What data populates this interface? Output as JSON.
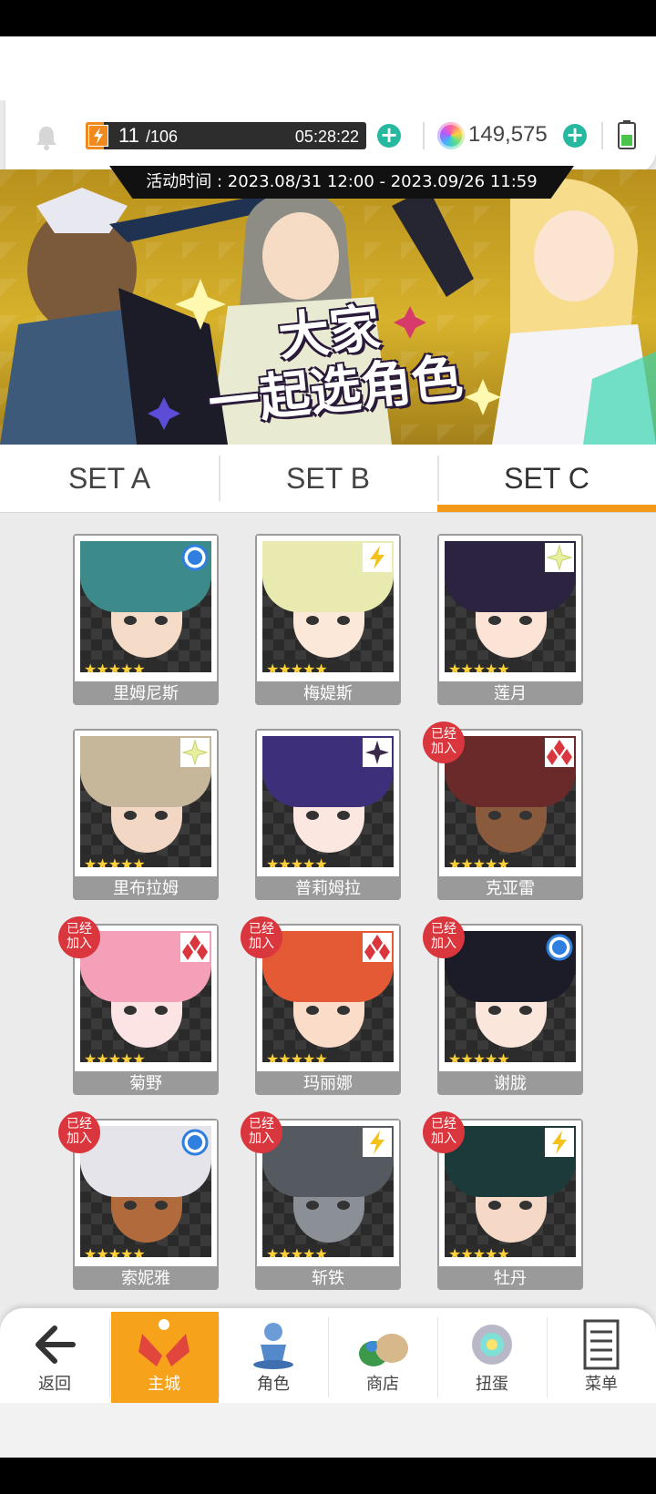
{
  "status": {
    "stamina_current": "11",
    "stamina_max": "/106",
    "stamina_timer": "05:28:22",
    "gems": "149,575",
    "icons": [
      "bell-icon",
      "lightning-icon",
      "plus-icon",
      "gem-icon",
      "battery-icon"
    ]
  },
  "banner": {
    "event_time": "活动时间 : 2023.08/31 12:00 - 2023.09/26 11:59",
    "title_line1": "大家",
    "title_line2": "一起选角色"
  },
  "tabs": [
    {
      "label": "SET A",
      "selected": false
    },
    {
      "label": "SET B",
      "selected": false
    },
    {
      "label": "SET C",
      "selected": true
    }
  ],
  "colors": {
    "accent": "#f39a18",
    "joined_badge": "#d9363e",
    "star": "#ffd13b",
    "plus_button": "#27b8a0"
  },
  "characters": [
    {
      "name": "里姆尼斯",
      "stars": "★★★★★",
      "attribute": "circle-icon",
      "joined": false
    },
    {
      "name": "梅媞斯",
      "stars": "★★★★★",
      "attribute": "lightning-icon",
      "joined": false
    },
    {
      "name": "莲月",
      "stars": "★★★★★",
      "attribute": "sparkle-icon",
      "joined": false
    },
    {
      "name": "里布拉姆",
      "stars": "★★★★★",
      "attribute": "sparkle-icon",
      "joined": false
    },
    {
      "name": "普莉姆拉",
      "stars": "★★★★★",
      "attribute": "dark-star-icon",
      "joined": false
    },
    {
      "name": "克亚雷",
      "stars": "★★★★★",
      "attribute": "diamonds-icon",
      "joined": true
    },
    {
      "name": "菊野",
      "stars": "★★★★★",
      "attribute": "diamonds-icon",
      "joined": true
    },
    {
      "name": "玛丽娜",
      "stars": "★★★★★",
      "attribute": "diamonds-icon",
      "joined": true
    },
    {
      "name": "谢胧",
      "stars": "★★★★★",
      "attribute": "circle-icon",
      "joined": true
    },
    {
      "name": "索妮雅",
      "stars": "★★★★★",
      "attribute": "circle-icon",
      "joined": true
    },
    {
      "name": "斩铁",
      "stars": "★★★★★",
      "attribute": "lightning-icon",
      "joined": true
    },
    {
      "name": "牡丹",
      "stars": "★★★★★",
      "attribute": "lightning-icon",
      "joined": true
    }
  ],
  "joined_label_line1": "已经",
  "joined_label_line2": "加入",
  "nav": [
    {
      "label": "返回",
      "icon": "back-arrow-icon"
    },
    {
      "label": "主城",
      "icon": "castle-icon",
      "active": true
    },
    {
      "label": "角色",
      "icon": "character-icon"
    },
    {
      "label": "商店",
      "icon": "shop-icon"
    },
    {
      "label": "扭蛋",
      "icon": "gacha-icon"
    },
    {
      "label": "菜单",
      "icon": "menu-icon"
    }
  ]
}
